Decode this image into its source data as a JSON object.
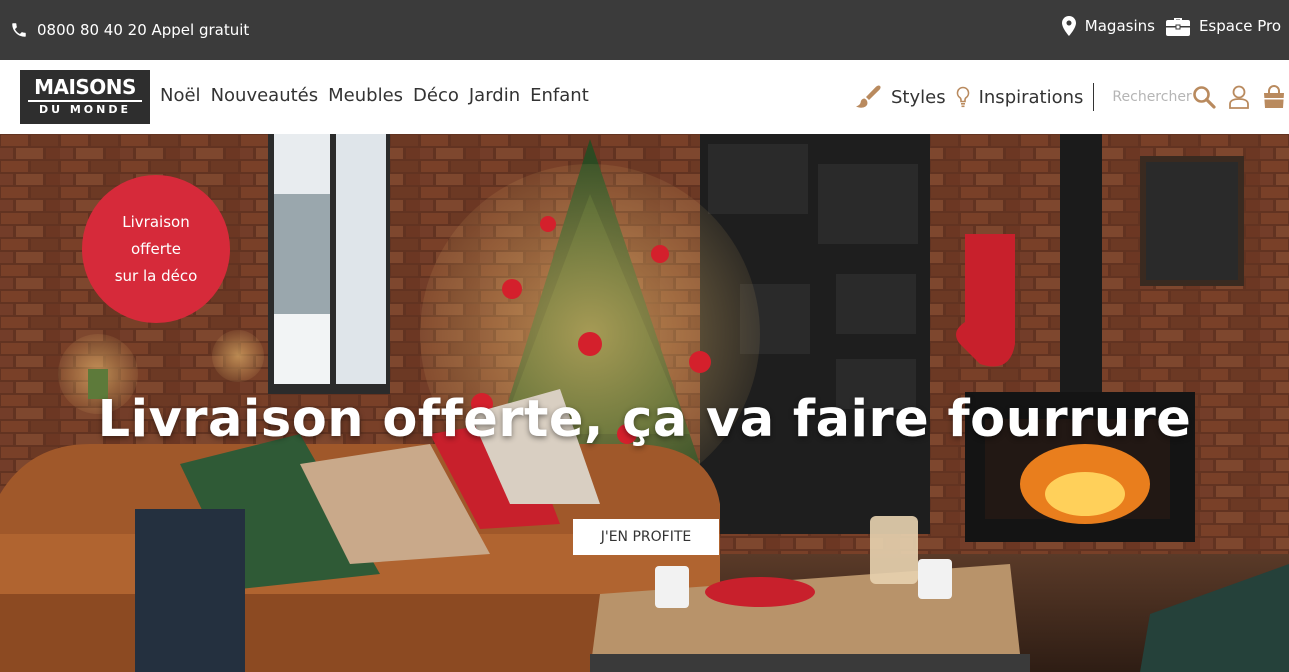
{
  "topbar": {
    "phone_text": "0800 80 40 20 Appel gratuit",
    "stores_label": "Magasins",
    "pro_label": "Espace Pro"
  },
  "logo": {
    "line1": "MAISONS",
    "line2": "DU MONDE"
  },
  "menu": {
    "items": [
      "Noël",
      "Nouveautés",
      "Meubles",
      "Déco",
      "Jardin",
      "Enfant"
    ]
  },
  "nav_right": {
    "styles_label": "Styles",
    "inspirations_label": "Inspirations",
    "search_placeholder": "Rechercher"
  },
  "hero": {
    "badge_lines": [
      "Livraison",
      "offerte",
      "sur la déco"
    ],
    "headline": "Livraison offerte, ça va faire fourrure",
    "cta_label": "J'EN PROFITE"
  },
  "colors": {
    "topbar_bg": "#3b3b3b",
    "badge_red": "#d62a3a",
    "accent_brown": "#b98a5e"
  },
  "icons": {
    "phone": "phone-icon",
    "stores": "map-pin-icon",
    "pro": "briefcase-icon",
    "styles": "paintbrush-icon",
    "inspirations": "lightbulb-icon",
    "search": "search-icon",
    "account": "user-icon",
    "cart": "shopping-bag-icon"
  }
}
